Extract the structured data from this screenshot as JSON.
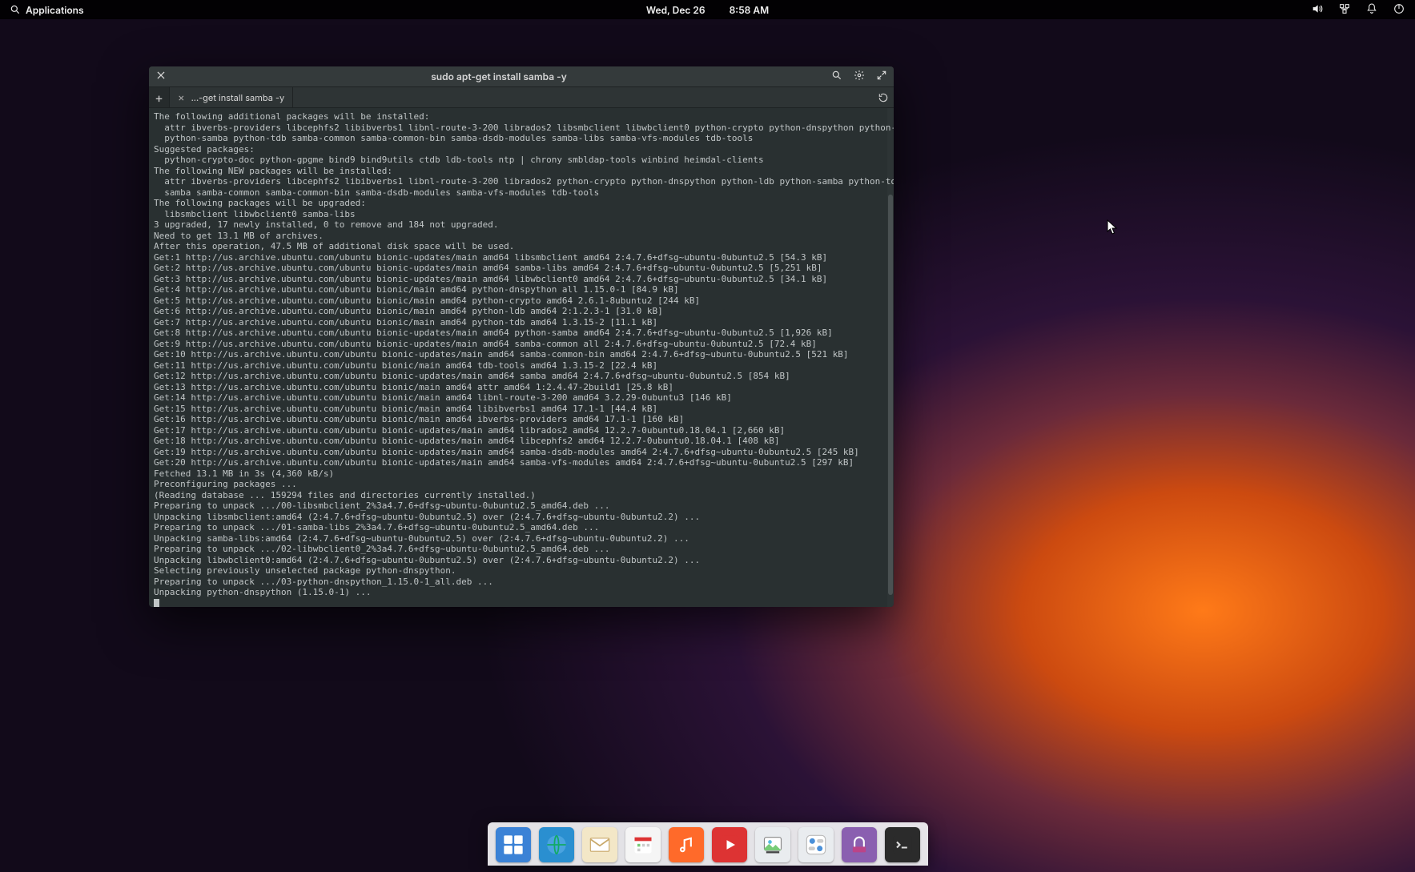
{
  "panel": {
    "applications_label": "Applications",
    "date_label": "Wed, Dec 26",
    "time_label": "8:58 AM",
    "tray": [
      "volume",
      "network",
      "notifications",
      "power"
    ]
  },
  "terminal": {
    "window_title": "sudo apt-get install samba -y",
    "tab_title": "...-get install samba -y",
    "output_lines": [
      "The following additional packages will be installed:",
      "  attr ibverbs-providers libcephfs2 libibverbs1 libnl-route-3-200 librados2 libsmbclient libwbclient0 python-crypto python-dnspython python-ldb",
      "  python-samba python-tdb samba-common samba-common-bin samba-dsdb-modules samba-libs samba-vfs-modules tdb-tools",
      "Suggested packages:",
      "  python-crypto-doc python-gpgme bind9 bind9utils ctdb ldb-tools ntp | chrony smbldap-tools winbind heimdal-clients",
      "The following NEW packages will be installed:",
      "  attr ibverbs-providers libcephfs2 libibverbs1 libnl-route-3-200 librados2 python-crypto python-dnspython python-ldb python-samba python-tdb",
      "  samba samba-common samba-common-bin samba-dsdb-modules samba-vfs-modules tdb-tools",
      "The following packages will be upgraded:",
      "  libsmbclient libwbclient0 samba-libs",
      "3 upgraded, 17 newly installed, 0 to remove and 184 not upgraded.",
      "Need to get 13.1 MB of archives.",
      "After this operation, 47.5 MB of additional disk space will be used.",
      "Get:1 http://us.archive.ubuntu.com/ubuntu bionic-updates/main amd64 libsmbclient amd64 2:4.7.6+dfsg~ubuntu-0ubuntu2.5 [54.3 kB]",
      "Get:2 http://us.archive.ubuntu.com/ubuntu bionic-updates/main amd64 samba-libs amd64 2:4.7.6+dfsg~ubuntu-0ubuntu2.5 [5,251 kB]",
      "Get:3 http://us.archive.ubuntu.com/ubuntu bionic-updates/main amd64 libwbclient0 amd64 2:4.7.6+dfsg~ubuntu-0ubuntu2.5 [34.1 kB]",
      "Get:4 http://us.archive.ubuntu.com/ubuntu bionic/main amd64 python-dnspython all 1.15.0-1 [84.9 kB]",
      "Get:5 http://us.archive.ubuntu.com/ubuntu bionic/main amd64 python-crypto amd64 2.6.1-8ubuntu2 [244 kB]",
      "Get:6 http://us.archive.ubuntu.com/ubuntu bionic/main amd64 python-ldb amd64 2:1.2.3-1 [31.0 kB]",
      "Get:7 http://us.archive.ubuntu.com/ubuntu bionic/main amd64 python-tdb amd64 1.3.15-2 [11.1 kB]",
      "Get:8 http://us.archive.ubuntu.com/ubuntu bionic-updates/main amd64 python-samba amd64 2:4.7.6+dfsg~ubuntu-0ubuntu2.5 [1,926 kB]",
      "Get:9 http://us.archive.ubuntu.com/ubuntu bionic-updates/main amd64 samba-common all 2:4.7.6+dfsg~ubuntu-0ubuntu2.5 [72.4 kB]",
      "Get:10 http://us.archive.ubuntu.com/ubuntu bionic-updates/main amd64 samba-common-bin amd64 2:4.7.6+dfsg~ubuntu-0ubuntu2.5 [521 kB]",
      "Get:11 http://us.archive.ubuntu.com/ubuntu bionic/main amd64 tdb-tools amd64 1.3.15-2 [22.4 kB]",
      "Get:12 http://us.archive.ubuntu.com/ubuntu bionic-updates/main amd64 samba amd64 2:4.7.6+dfsg~ubuntu-0ubuntu2.5 [854 kB]",
      "Get:13 http://us.archive.ubuntu.com/ubuntu bionic/main amd64 attr amd64 1:2.4.47-2build1 [25.8 kB]",
      "Get:14 http://us.archive.ubuntu.com/ubuntu bionic/main amd64 libnl-route-3-200 amd64 3.2.29-0ubuntu3 [146 kB]",
      "Get:15 http://us.archive.ubuntu.com/ubuntu bionic/main amd64 libibverbs1 amd64 17.1-1 [44.4 kB]",
      "Get:16 http://us.archive.ubuntu.com/ubuntu bionic/main amd64 ibverbs-providers amd64 17.1-1 [160 kB]",
      "Get:17 http://us.archive.ubuntu.com/ubuntu bionic-updates/main amd64 librados2 amd64 12.2.7-0ubuntu0.18.04.1 [2,660 kB]",
      "Get:18 http://us.archive.ubuntu.com/ubuntu bionic-updates/main amd64 libcephfs2 amd64 12.2.7-0ubuntu0.18.04.1 [408 kB]",
      "Get:19 http://us.archive.ubuntu.com/ubuntu bionic-updates/main amd64 samba-dsdb-modules amd64 2:4.7.6+dfsg~ubuntu-0ubuntu2.5 [245 kB]",
      "Get:20 http://us.archive.ubuntu.com/ubuntu bionic-updates/main amd64 samba-vfs-modules amd64 2:4.7.6+dfsg~ubuntu-0ubuntu2.5 [297 kB]",
      "Fetched 13.1 MB in 3s (4,360 kB/s)",
      "Preconfiguring packages ...",
      "(Reading database ... 159294 files and directories currently installed.)",
      "Preparing to unpack .../00-libsmbclient_2%3a4.7.6+dfsg~ubuntu-0ubuntu2.5_amd64.deb ...",
      "Unpacking libsmbclient:amd64 (2:4.7.6+dfsg~ubuntu-0ubuntu2.5) over (2:4.7.6+dfsg~ubuntu-0ubuntu2.2) ...",
      "Preparing to unpack .../01-samba-libs_2%3a4.7.6+dfsg~ubuntu-0ubuntu2.5_amd64.deb ...",
      "Unpacking samba-libs:amd64 (2:4.7.6+dfsg~ubuntu-0ubuntu2.5) over (2:4.7.6+dfsg~ubuntu-0ubuntu2.2) ...",
      "Preparing to unpack .../02-libwbclient0_2%3a4.7.6+dfsg~ubuntu-0ubuntu2.5_amd64.deb ...",
      "Unpacking libwbclient0:amd64 (2:4.7.6+dfsg~ubuntu-0ubuntu2.5) over (2:4.7.6+dfsg~ubuntu-0ubuntu2.2) ...",
      "Selecting previously unselected package python-dnspython.",
      "Preparing to unpack .../03-python-dnspython_1.15.0-1_all.deb ...",
      "Unpacking python-dnspython (1.15.0-1) ..."
    ]
  },
  "dock": {
    "apps": [
      {
        "name": "multitasking",
        "color": "#3b82d6"
      },
      {
        "name": "web-browser",
        "color": "#2a8fd0"
      },
      {
        "name": "mail",
        "color": "#f3e7c7"
      },
      {
        "name": "calendar",
        "color": "#f5f5f5"
      },
      {
        "name": "music",
        "color": "#ff6a2a"
      },
      {
        "name": "videos",
        "color": "#d33"
      },
      {
        "name": "photos",
        "color": "#e9ecef"
      },
      {
        "name": "switchboard",
        "color": "#e9ecef"
      },
      {
        "name": "appcenter",
        "color": "#8a5fb0"
      },
      {
        "name": "terminal",
        "color": "#2b2b2b"
      }
    ]
  }
}
